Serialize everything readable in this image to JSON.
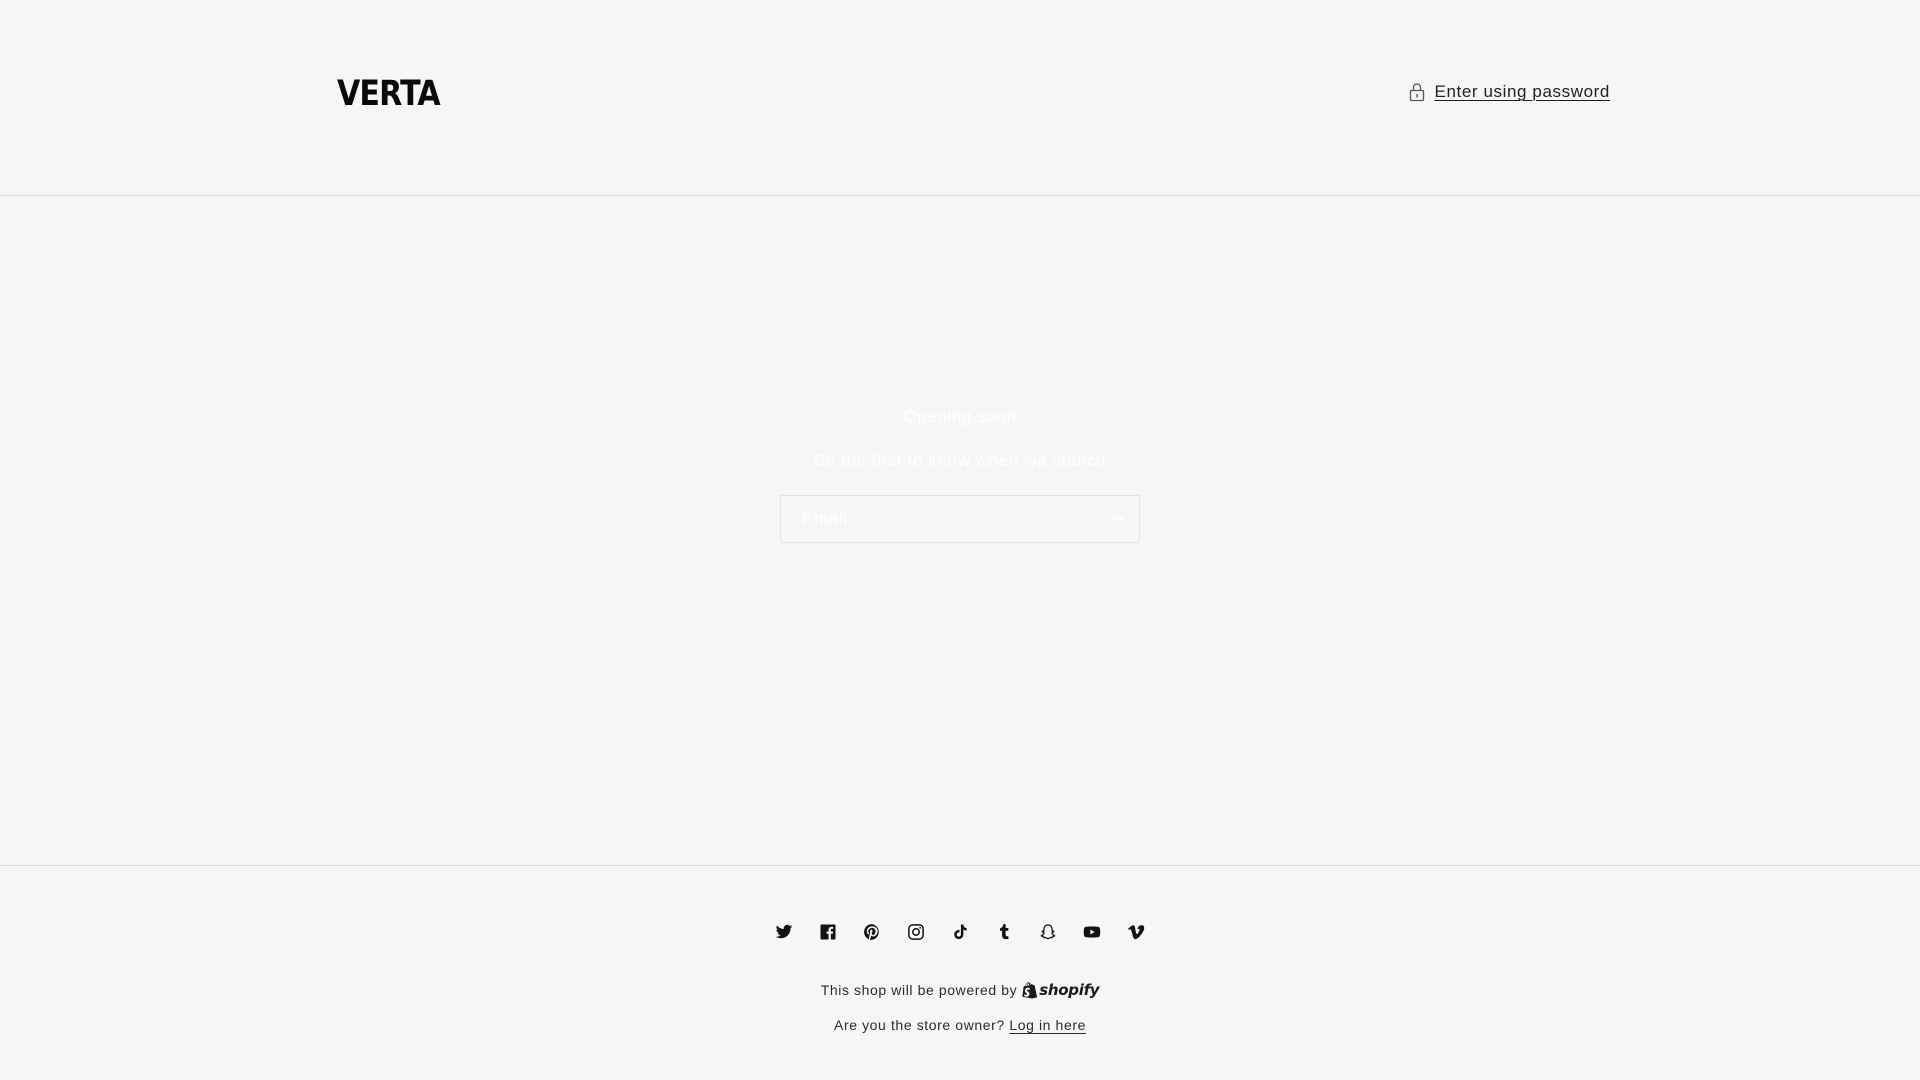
{
  "header": {
    "logo": "VERTA",
    "password_link": "Enter using password"
  },
  "main": {
    "heading": "Opening soon",
    "subheading": "Be the first to know when we launch",
    "email_placeholder": "Email"
  },
  "footer": {
    "socials": [
      {
        "name": "twitter-icon"
      },
      {
        "name": "facebook-icon"
      },
      {
        "name": "pinterest-icon"
      },
      {
        "name": "instagram-icon"
      },
      {
        "name": "tiktok-icon"
      },
      {
        "name": "tumblr-icon"
      },
      {
        "name": "snapchat-icon"
      },
      {
        "name": "youtube-icon"
      },
      {
        "name": "vimeo-icon"
      }
    ],
    "powered_text": "This shop will be powered by",
    "shopify_word": "shopify",
    "owner_text": "Are you the store owner?",
    "login_link": "Log in here"
  },
  "colors": {
    "background": "#f6f6f6",
    "text": "#121212",
    "divider": "#d9d9d9"
  }
}
